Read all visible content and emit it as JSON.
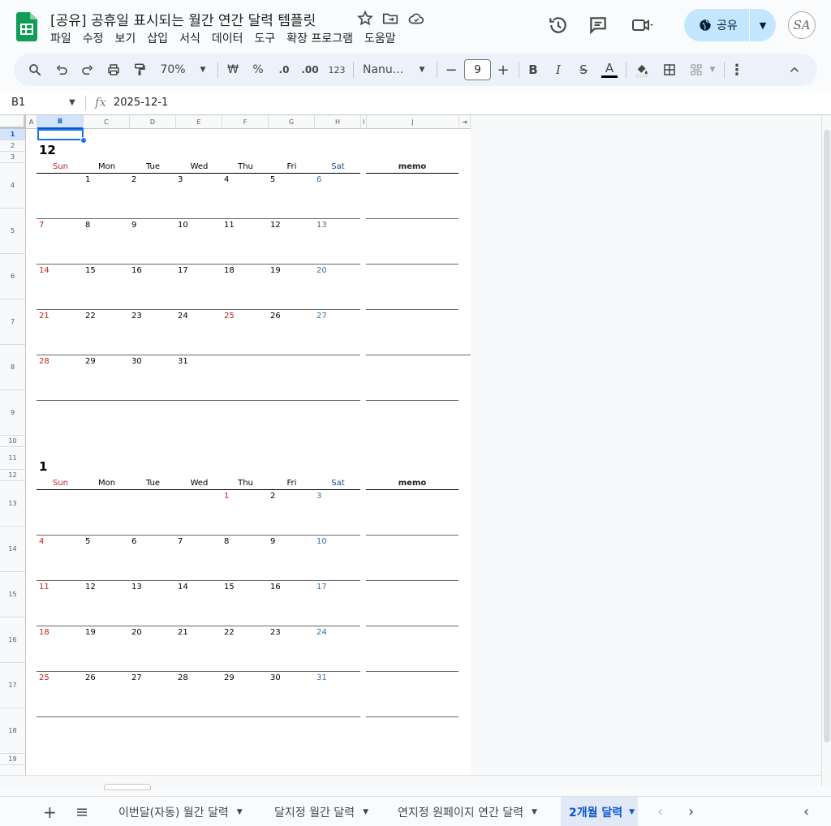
{
  "doc": {
    "title": "[공유] 공휴일 표시되는 월간 연간 달력 템플릿",
    "menu": [
      "파일",
      "수정",
      "보기",
      "삽입",
      "서식",
      "데이터",
      "도구",
      "확장 프로그램",
      "도움말"
    ],
    "share_label": "공유",
    "avatar_text": "SA"
  },
  "toolbar": {
    "zoom": "70%",
    "currency": "₩",
    "percent": "%",
    "decrease_decimal": ".0",
    "increase_decimal": ".00",
    "number_format": "123",
    "font_name": "Nanu...",
    "font_size": "9"
  },
  "formula": {
    "cell_ref": "B1",
    "value": "2025-12-1"
  },
  "columns": [
    "A",
    "B",
    "C",
    "D",
    "E",
    "F",
    "G",
    "H",
    "I",
    "J"
  ],
  "rows": [
    "1",
    "2",
    "3",
    "4",
    "5",
    "6",
    "7",
    "8",
    "9",
    "10",
    "11",
    "12",
    "13",
    "14",
    "15",
    "16",
    "17",
    "18",
    "19"
  ],
  "calendar": {
    "weekdays": [
      "Sun",
      "Mon",
      "Tue",
      "Wed",
      "Thu",
      "Fri",
      "Sat"
    ],
    "memo_label": "memo",
    "months": [
      {
        "number": "12",
        "weeks": [
          [
            "",
            "1",
            "2",
            "3",
            "4",
            "5",
            "6"
          ],
          [
            "7",
            "8",
            "9",
            "10",
            "11",
            "12",
            "13"
          ],
          [
            "14",
            "15",
            "16",
            "17",
            "18",
            "19",
            "20"
          ],
          [
            "21",
            "22",
            "23",
            "24",
            "25",
            "26",
            "27"
          ],
          [
            "28",
            "29",
            "30",
            "31",
            "",
            "",
            ""
          ]
        ],
        "holidays": [
          "25"
        ]
      },
      {
        "number": "1",
        "weeks": [
          [
            "",
            "",
            "",
            "",
            "1",
            "2",
            "3"
          ],
          [
            "4",
            "5",
            "6",
            "7",
            "8",
            "9",
            "10"
          ],
          [
            "11",
            "12",
            "13",
            "14",
            "15",
            "16",
            "17"
          ],
          [
            "18",
            "19",
            "20",
            "21",
            "22",
            "23",
            "24"
          ],
          [
            "25",
            "26",
            "27",
            "28",
            "29",
            "30",
            "31"
          ]
        ],
        "holidays": [
          "1"
        ]
      }
    ]
  },
  "sheet_tabs": [
    {
      "label": "이번달(자동) 월간 달력",
      "active": false
    },
    {
      "label": "달지정 월간 달력",
      "active": false
    },
    {
      "label": "연지정 원페이지 연간 달력",
      "active": false
    },
    {
      "label": "2개월 달력",
      "active": true
    }
  ],
  "colors": {
    "sunday": "#c5221f",
    "saturday": "#3d6fa0",
    "accent": "#0b57d0",
    "share_bg": "#c2e7ff"
  }
}
